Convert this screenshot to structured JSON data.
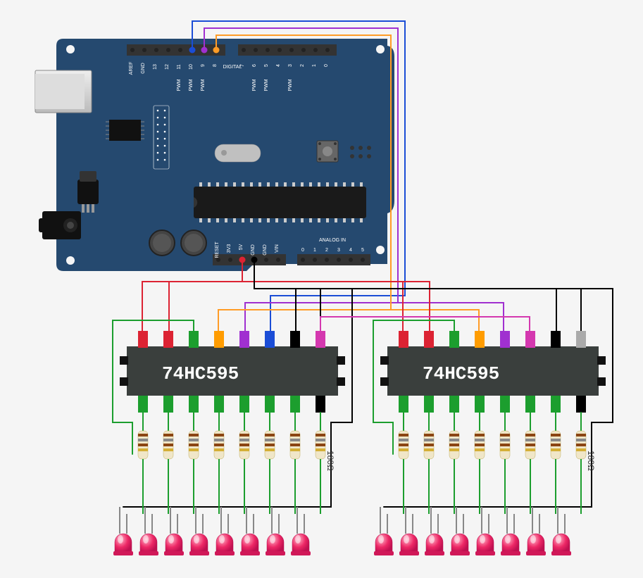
{
  "chip1_label": "74HC595",
  "chip2_label": "74HC595",
  "resistor_value": "180Ω",
  "arduino": {
    "digital_label": "DIGITAL",
    "analog_label": "ANALOG IN",
    "top_pins": [
      "AREF",
      "GND",
      "13",
      "12",
      "11",
      "10",
      "9",
      "8",
      "",
      "7",
      "6",
      "5",
      "4",
      "3",
      "2",
      "1",
      "0"
    ],
    "pwm_under": {
      "11": "PWM",
      "10": "PWM",
      "9": "PWM",
      "6": "PWM",
      "5": "PWM",
      "3": "PWM"
    },
    "power_pins": [
      "RESET",
      "3V3",
      "5V",
      "GND",
      "GND",
      "VIN"
    ],
    "analog_pins": [
      "0",
      "1",
      "2",
      "3",
      "4",
      "5"
    ]
  },
  "chart_data": {
    "type": "diagram",
    "description": "Arduino Uno wired to two cascaded 74HC595 shift registers driving 16 LEDs through 180Ω resistors.",
    "components": [
      {
        "name": "Arduino Uno",
        "pins_used": [
          "D8",
          "D9",
          "D10",
          "5V",
          "GND"
        ]
      },
      {
        "name": "74HC595",
        "qty": 2
      },
      {
        "name": "Resistor",
        "value_ohms": 180,
        "qty": 16
      },
      {
        "name": "LED",
        "color": "red",
        "qty": 16
      }
    ],
    "connections": [
      {
        "from": "Arduino D10",
        "to": "IC1 DATA",
        "color": "blue"
      },
      {
        "from": "Arduino D9",
        "to": "IC1 LATCH + IC2 LATCH",
        "color": "purple"
      },
      {
        "from": "Arduino D8",
        "to": "IC1 CLOCK + IC2 CLOCK",
        "color": "orange"
      },
      {
        "from": "Arduino 5V",
        "to": "IC1 VCC + IC2 VCC + IC1 MR + IC2 MR",
        "color": "red"
      },
      {
        "from": "Arduino GND",
        "to": "IC1 GND + IC2 GND + IC1 OE + IC2 OE + LED cathodes",
        "color": "black"
      },
      {
        "from": "IC1 Q7S",
        "to": "IC2 DATA (cascade)",
        "color": "magenta"
      },
      {
        "from": "IC1 Q0..Q7",
        "to": "R1..R8 → LED1..LED8",
        "color": "green"
      },
      {
        "from": "IC2 Q0..Q7",
        "to": "R9..R16 → LED9..LED16",
        "color": "green"
      }
    ]
  }
}
